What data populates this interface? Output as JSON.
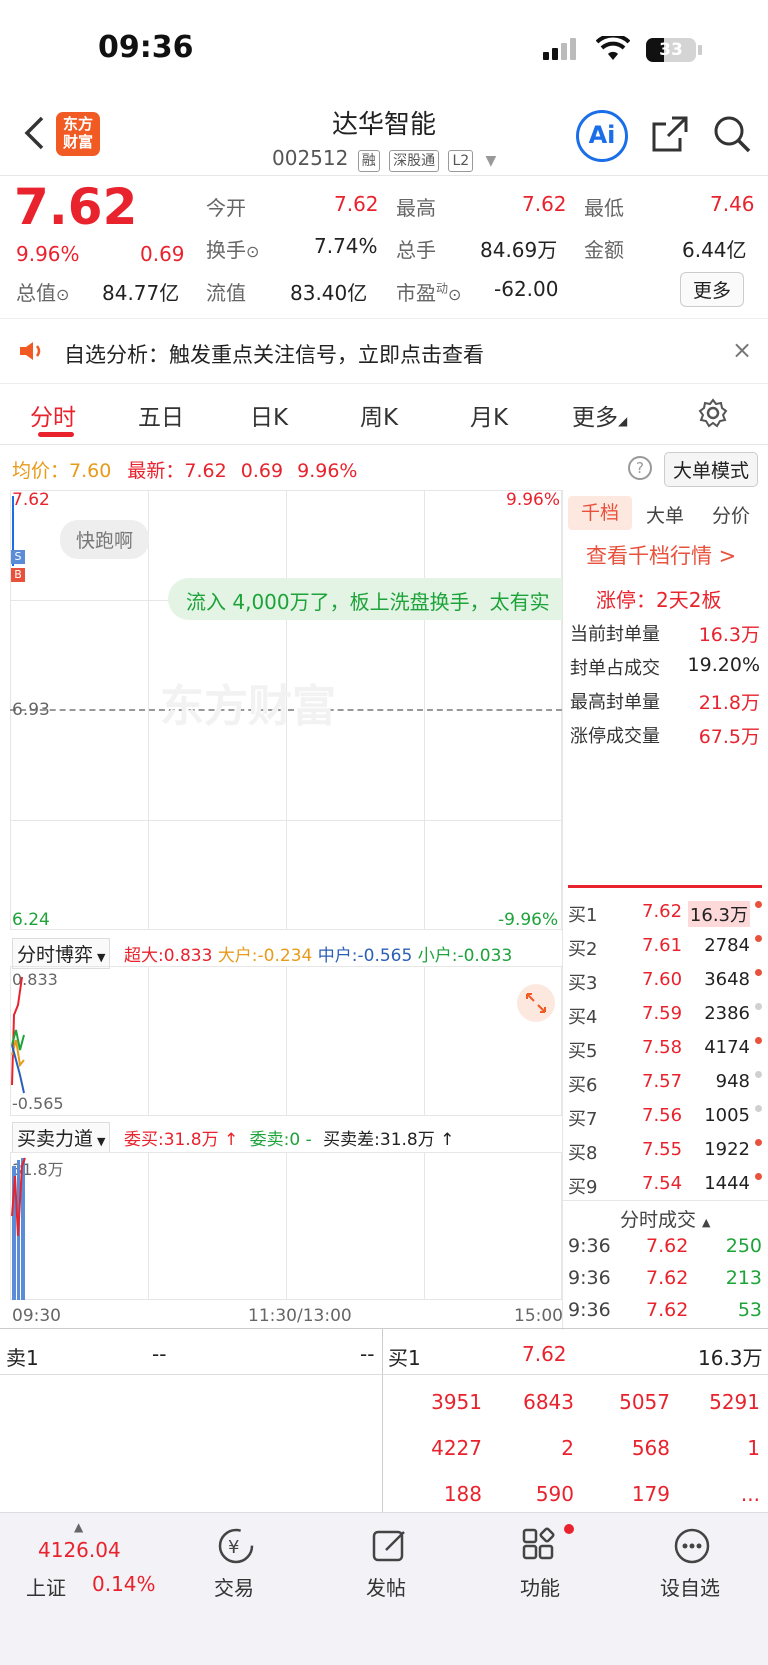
{
  "status_bar": {
    "time": "09:36",
    "battery": "33"
  },
  "header": {
    "logo_text": "东方\n财富",
    "stock_name": "达华智能",
    "stock_code": "002512",
    "badges": [
      "融",
      "深股通",
      "L2"
    ],
    "ai_label": "Ai"
  },
  "quote": {
    "price": "7.62",
    "change_pct": "9.96%",
    "change_amt": "0.69",
    "open_label": "今开",
    "open": "7.62",
    "high_label": "最高",
    "high": "7.62",
    "low_label": "最低",
    "low": "7.46",
    "turnover_label": "换手",
    "turnover": "7.74%",
    "volume_label": "总手",
    "volume": "84.69万",
    "amount_label": "金额",
    "amount": "6.44亿",
    "mktcap_label": "总值",
    "mktcap": "84.77亿",
    "float_label": "流值",
    "float_cap": "83.40亿",
    "pe_label": "市盈",
    "pe_sup": "动",
    "pe": "-62.00",
    "more_button": "更多"
  },
  "notice": {
    "text": "自选分析：触发重点关注信号，立即点击查看"
  },
  "tabs": [
    "分时",
    "五日",
    "日K",
    "周K",
    "月K",
    "更多"
  ],
  "info_line": {
    "avg_label": "均价：",
    "avg": "7.60",
    "latest_label": "最新：",
    "latest": "7.62",
    "chg": "0.69",
    "pct": "9.96%",
    "big_order_mode": "大单模式"
  },
  "chart": {
    "y_top": "7.62",
    "y_mid": "6.93",
    "y_bot": "6.24",
    "pct_top": "9.96%",
    "pct_bot": "-9.96%",
    "bubble": "快跑啊",
    "banner": "流入 4,000万了，板上洗盘换手，太有实",
    "watermark": "东方财富",
    "marker_s": "S",
    "marker_b": "B",
    "time_start": "09:30",
    "time_mid": "11:30/13:00",
    "time_end": "15:00"
  },
  "game_panel": {
    "title": "分时博弈",
    "super_label": "超大:",
    "super": "0.833",
    "big_label": "大户:",
    "big": "-0.234",
    "mid_label": "中户:",
    "mid": "-0.565",
    "small_label": "小户:",
    "small": "-0.033",
    "y_top": "0.833",
    "y_bot": "-0.565"
  },
  "force_panel": {
    "title": "买卖力道",
    "buy_label": "委买:",
    "buy": "31.8万 ↑",
    "sell_label": "委卖:",
    "sell": "0 -",
    "diff_label": "买卖差:",
    "diff": "31.8万 ↑",
    "y_top": "31.8万"
  },
  "right_panel": {
    "tabs": [
      "千档",
      "大单",
      "分价"
    ],
    "view_link": "查看千档行情 >",
    "limit_up": "涨停：2天2板",
    "stats": [
      {
        "label": "当前封单量",
        "value": "16.3万"
      },
      {
        "label": "封单占成交",
        "value": "19.20%"
      },
      {
        "label": "最高封单量",
        "value": "21.8万"
      },
      {
        "label": "涨停成交量",
        "value": "67.5万"
      }
    ],
    "bids": [
      {
        "label": "买1",
        "price": "7.62",
        "vol": "16.3万",
        "dot": "#e8523d"
      },
      {
        "label": "买2",
        "price": "7.61",
        "vol": "2784",
        "dot": "#e8523d"
      },
      {
        "label": "买3",
        "price": "7.60",
        "vol": "3648",
        "dot": "#e8523d"
      },
      {
        "label": "买4",
        "price": "7.59",
        "vol": "2386",
        "dot": "#d0d0d0"
      },
      {
        "label": "买5",
        "price": "7.58",
        "vol": "4174",
        "dot": "#e8523d"
      },
      {
        "label": "买6",
        "price": "7.57",
        "vol": "948",
        "dot": "#d0d0d0"
      },
      {
        "label": "买7",
        "price": "7.56",
        "vol": "1005",
        "dot": "#d0d0d0"
      },
      {
        "label": "买8",
        "price": "7.55",
        "vol": "1922",
        "dot": "#e8523d"
      },
      {
        "label": "买9",
        "price": "7.54",
        "vol": "1444",
        "dot": "#e8523d"
      }
    ],
    "trades_title": "分时成交",
    "trades": [
      {
        "time": "9:36",
        "price": "7.62",
        "vol": "250"
      },
      {
        "time": "9:36",
        "price": "7.62",
        "vol": "213"
      },
      {
        "time": "9:36",
        "price": "7.62",
        "vol": "53"
      }
    ]
  },
  "bottom_book": {
    "sell1_label": "卖1",
    "sell1_price": "--",
    "sell1_vol": "--",
    "buy1_label": "买1",
    "buy1_price": "7.62",
    "buy1_vol": "16.3万",
    "queue": [
      [
        "3951",
        "6843",
        "5057",
        "5291"
      ],
      [
        "4227",
        "2",
        "568",
        "1"
      ],
      [
        "188",
        "590",
        "179",
        "..."
      ]
    ]
  },
  "bottom_nav": {
    "index_value": "4126.04",
    "index_name": "上证",
    "index_pct": "0.14%",
    "items": [
      "交易",
      "发帖",
      "功能",
      "设自选"
    ]
  }
}
